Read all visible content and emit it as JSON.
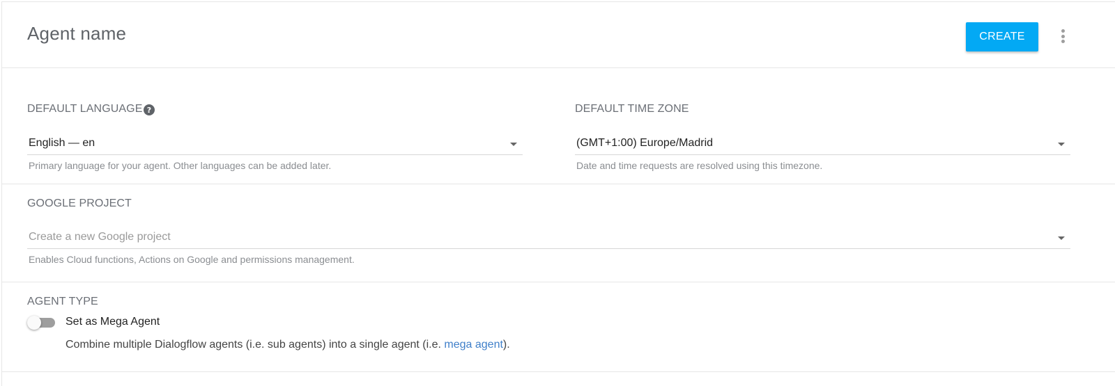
{
  "header": {
    "agent_name": "Agent name",
    "create_label": "CREATE",
    "more_icon": "more-vert-icon"
  },
  "language": {
    "label": "DEFAULT LANGUAGE",
    "help_icon": "help-circle-icon",
    "help_glyph": "?",
    "value": "English — en",
    "hint": "Primary language for your agent. Other languages can be added later."
  },
  "timezone": {
    "label": "DEFAULT TIME ZONE",
    "value": "(GMT+1:00) Europe/Madrid",
    "hint": "Date and time requests are resolved using this timezone."
  },
  "project": {
    "label": "GOOGLE PROJECT",
    "placeholder": "Create a new Google project",
    "hint": "Enables Cloud functions, Actions on Google and permissions management."
  },
  "agent_type": {
    "label": "AGENT TYPE",
    "toggle_label": "Set as Mega Agent",
    "toggle_on": false,
    "desc_prefix": "Combine multiple Dialogflow agents (i.e. sub agents) into a single agent (i.e. ",
    "desc_link": "mega agent",
    "desc_suffix": ").",
    "link_color": "#3f7fc9"
  },
  "colors": {
    "accent": "#03a9f4"
  }
}
